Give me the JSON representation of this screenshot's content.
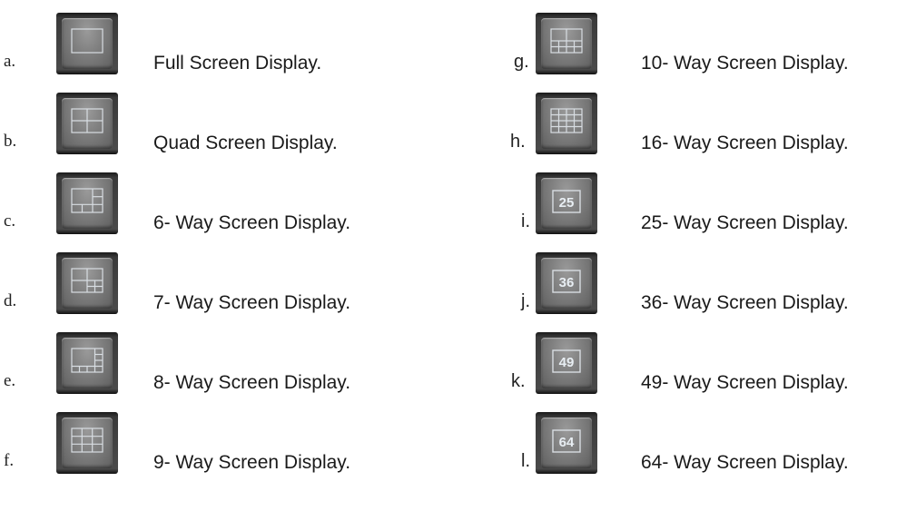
{
  "items": [
    {
      "letter": "a.",
      "label": "Full Screen Display.",
      "icon": "full-screen-layout-icon"
    },
    {
      "letter": "b.",
      "label": "Quad Screen Display.",
      "icon": "quad-screen-layout-icon"
    },
    {
      "letter": "c.",
      "label": "6- Way Screen Display.",
      "icon": "six-way-layout-icon"
    },
    {
      "letter": "d.",
      "label": "7- Way Screen Display.",
      "icon": "seven-way-layout-icon"
    },
    {
      "letter": "e.",
      "label": "8- Way Screen Display.",
      "icon": "eight-way-layout-icon"
    },
    {
      "letter": "f.",
      "label": "9- Way Screen Display.",
      "icon": "nine-way-layout-icon"
    },
    {
      "letter": "g.",
      "label": "10- Way Screen Display.",
      "icon": "ten-way-layout-icon"
    },
    {
      "letter": "h.",
      "label": "16- Way Screen Display.",
      "icon": "sixteen-way-layout-icon"
    },
    {
      "letter": "i.",
      "label": "25- Way Screen Display.",
      "icon": "twenty-five-way-icon",
      "number": "25"
    },
    {
      "letter": "j.",
      "label": "36- Way Screen Display.",
      "icon": "thirty-six-way-icon",
      "number": "36"
    },
    {
      "letter": "k.",
      "label": "49- Way Screen Display.",
      "icon": "forty-nine-way-icon",
      "number": "49"
    },
    {
      "letter": "l.",
      "label": "64- Way Screen Display.",
      "icon": "sixty-four-way-icon",
      "number": "64"
    }
  ]
}
